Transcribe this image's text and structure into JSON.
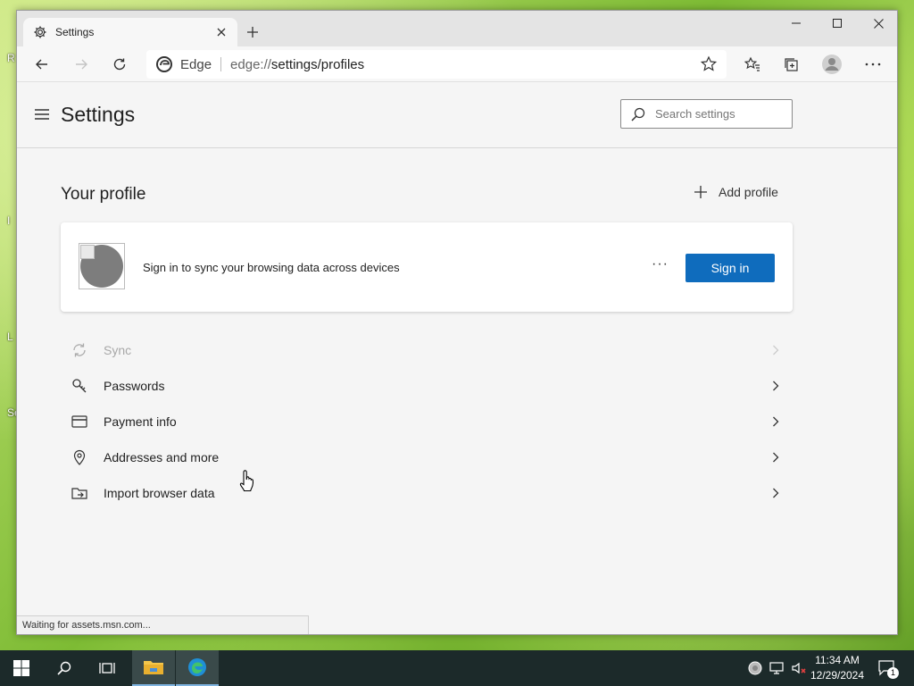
{
  "desktop": {
    "fragments": [
      "R",
      "I",
      "L",
      "Se"
    ]
  },
  "browser": {
    "tab": {
      "title": "Settings",
      "icon": "gear-icon"
    },
    "toolbar": {
      "site_name": "Edge",
      "url_scheme": "edge://",
      "url_path": "settings/profiles"
    }
  },
  "settings": {
    "title": "Settings",
    "search": {
      "placeholder": "Search settings"
    },
    "profile": {
      "section_title": "Your profile",
      "add_profile_label": "Add profile",
      "card": {
        "message": "Sign in to sync your browsing data across devices",
        "more_label": "···",
        "signin_label": "Sign in"
      },
      "items": [
        {
          "label": "Sync",
          "icon": "sync-icon",
          "disabled": true
        },
        {
          "label": "Passwords",
          "icon": "key-icon",
          "disabled": false
        },
        {
          "label": "Payment info",
          "icon": "credit-card-icon",
          "disabled": false
        },
        {
          "label": "Addresses and more",
          "icon": "location-pin-icon",
          "disabled": false
        },
        {
          "label": "Import browser data",
          "icon": "import-folder-icon",
          "disabled": false
        }
      ]
    }
  },
  "status_bar": {
    "text": "Waiting for assets.msn.com..."
  },
  "taskbar": {
    "clock_time": "11:34 AM",
    "clock_date": "12/29/2024",
    "notification_count": "1"
  },
  "colors": {
    "accent": "#0f6cbd",
    "taskbar": "#1c2a2a"
  }
}
